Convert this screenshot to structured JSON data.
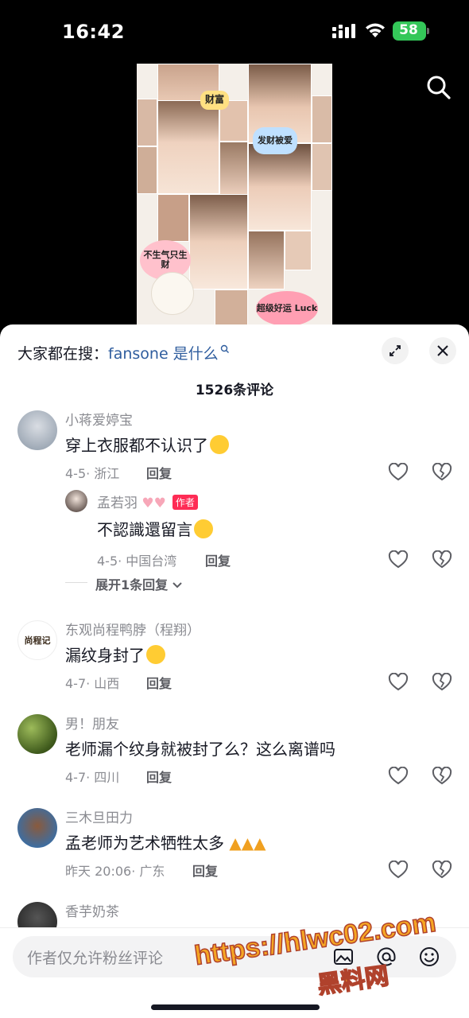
{
  "status_bar": {
    "time": "16:42",
    "battery": "58"
  },
  "video": {
    "stickers": [
      "财富",
      "发财被爱",
      "不生气只生财",
      "超级好运 Luck"
    ]
  },
  "sheet": {
    "search_hint_prefix": "大家都在搜：",
    "search_hint_keyword": "fansone 是什么",
    "comment_count": "1526条评论",
    "expand_label": "展开1条回复"
  },
  "comments": [
    {
      "user": "小蒋爱婷宝",
      "text": "穿上衣服都不认识了",
      "date_loc": "4-5· 浙江",
      "reply": "回复"
    },
    {
      "user": "孟若羽",
      "tag": "作者",
      "text": "不認識還留言",
      "date_loc": "4-5· 中国台湾",
      "reply": "回复"
    },
    {
      "user": "东观尚程鸭脖（程翔）",
      "avatar_text": "尚程记",
      "text": "漏纹身封了",
      "date_loc": "4-7· 山西",
      "reply": "回复"
    },
    {
      "user": "男！朋友",
      "text": "老师漏个纹身就被封了么？这么离谱吗",
      "date_loc": "4-7· 四川",
      "reply": "回复"
    },
    {
      "user": "三木旦田力",
      "text": "孟老师为艺术牺牲太多",
      "date_loc": "昨天 20:06· 广东",
      "reply": "回复"
    },
    {
      "user": "香芋奶茶"
    }
  ],
  "input": {
    "placeholder": "作者仅允许粉丝评论"
  },
  "watermark": {
    "line1": "https://hlwc02.com",
    "line2": "黑料网"
  },
  "colors": {
    "author_tag": "#fe2c55",
    "battery": "#34c759",
    "keyword": "#2f5d9e"
  }
}
